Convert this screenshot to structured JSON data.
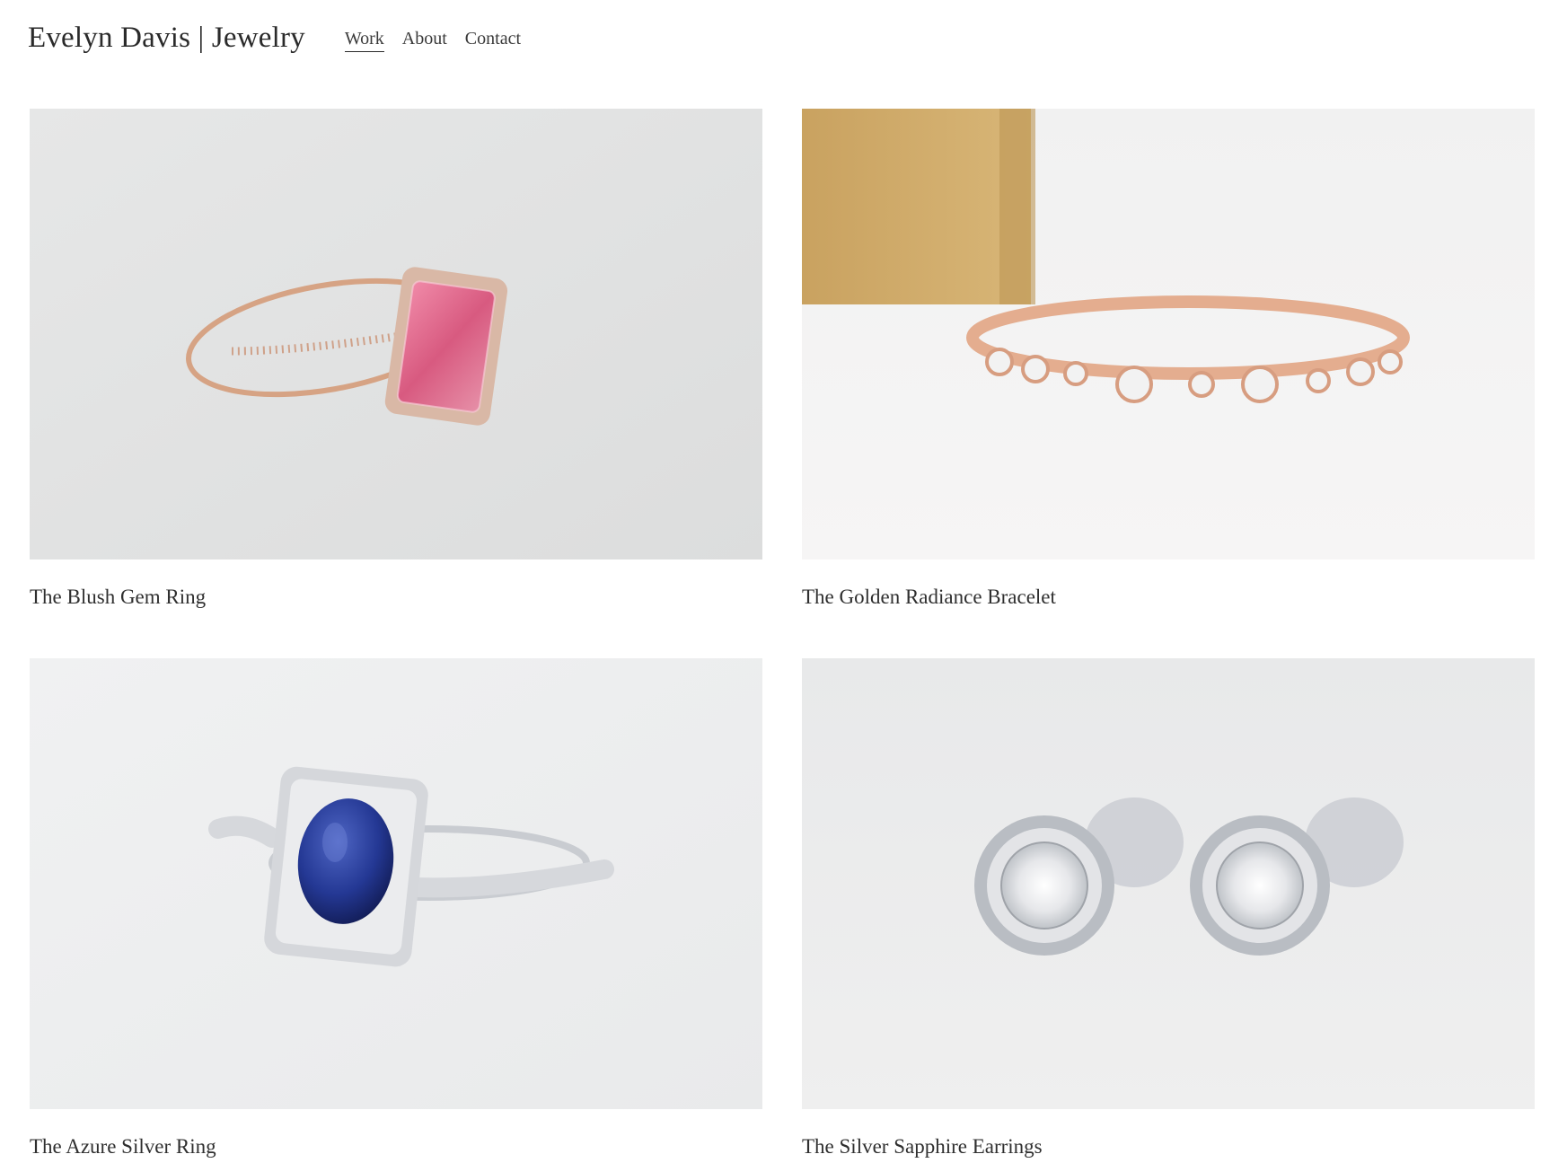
{
  "site": {
    "title": "Evelyn Davis | Jewelry"
  },
  "nav": {
    "items": [
      {
        "label": "Work",
        "active": true
      },
      {
        "label": "About",
        "active": false
      },
      {
        "label": "Contact",
        "active": false
      }
    ]
  },
  "gallery": {
    "items": [
      {
        "title": "The Blush Gem Ring",
        "image": "pink-gemstone-rose-gold-ring-photo"
      },
      {
        "title": "The Golden Radiance Bracelet",
        "image": "rose-gold-diamond-band-photo"
      },
      {
        "title": "The Azure Silver Ring",
        "image": "blue-sapphire-silver-ring-photo"
      },
      {
        "title": "The Silver Sapphire Earrings",
        "image": "diamond-halo-stud-earrings-photo"
      }
    ]
  },
  "colors": {
    "text": "#2b2b2b",
    "background": "#ffffff",
    "rose_gold": "#d9a083",
    "pink_gem": "#e0708f",
    "sapphire": "#1f2f7a",
    "silver": "#c9ccd2"
  }
}
